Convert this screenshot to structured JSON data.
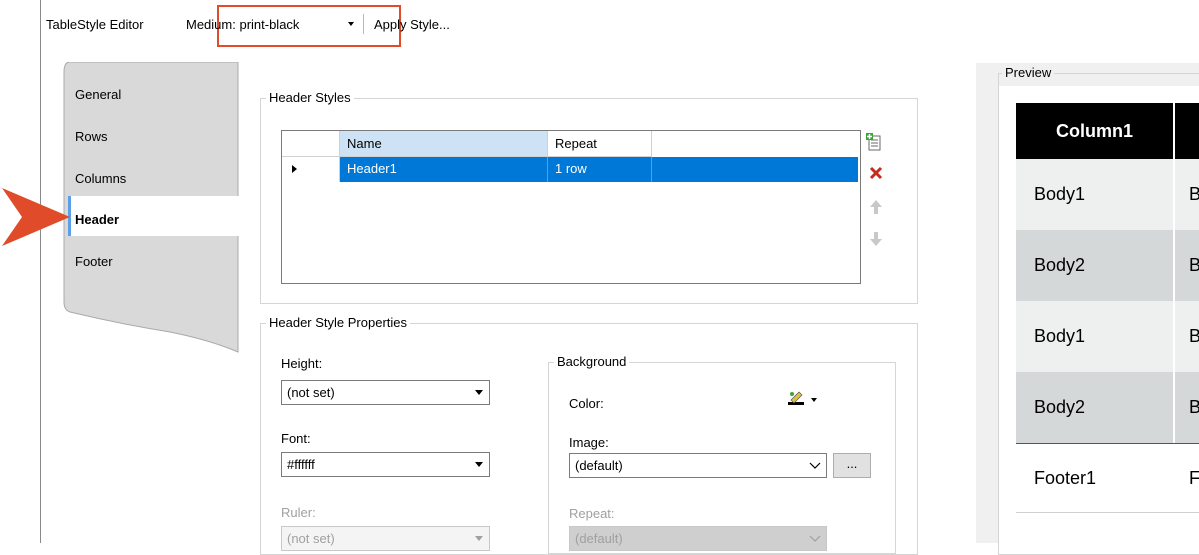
{
  "toolbar": {
    "title": "TableStyle Editor",
    "medium_dropdown": "Medium: print-black",
    "apply_style": "Apply Style..."
  },
  "tabs": [
    {
      "label": "General",
      "selected": false
    },
    {
      "label": "Rows",
      "selected": false
    },
    {
      "label": "Columns",
      "selected": false
    },
    {
      "label": "Header",
      "selected": true
    },
    {
      "label": "Footer",
      "selected": false
    }
  ],
  "header_styles": {
    "title": "Header Styles",
    "columns": [
      "Name",
      "Repeat"
    ],
    "rows": [
      {
        "name": "Header1",
        "repeat": "1 row"
      }
    ]
  },
  "header_style_properties": {
    "title": "Header Style Properties",
    "height_label": "Height:",
    "height_value": "(not set)",
    "font_label": "Font:",
    "font_value": "#ffffff",
    "ruler_label": "Ruler:",
    "ruler_value": "(not set)",
    "background": {
      "title": "Background",
      "color_label": "Color:",
      "image_label": "Image:",
      "image_value": "(default)",
      "browse_label": "...",
      "repeat_label": "Repeat:",
      "repeat_value": "(default)"
    }
  },
  "preview": {
    "title": "Preview",
    "header": "Column1",
    "body_rows": [
      "Body1",
      "Body2",
      "Body1",
      "Body2"
    ],
    "second_col_rows": [
      "B",
      "B",
      "B",
      "B"
    ],
    "footer": "Footer1",
    "footer_second": "F"
  },
  "colors": {
    "selection": "#0078d7",
    "callout": "#e04b2a",
    "header_bg": "#000000",
    "zebra_light": "#eef0ef",
    "zebra_dark": "#d5d8d9"
  }
}
